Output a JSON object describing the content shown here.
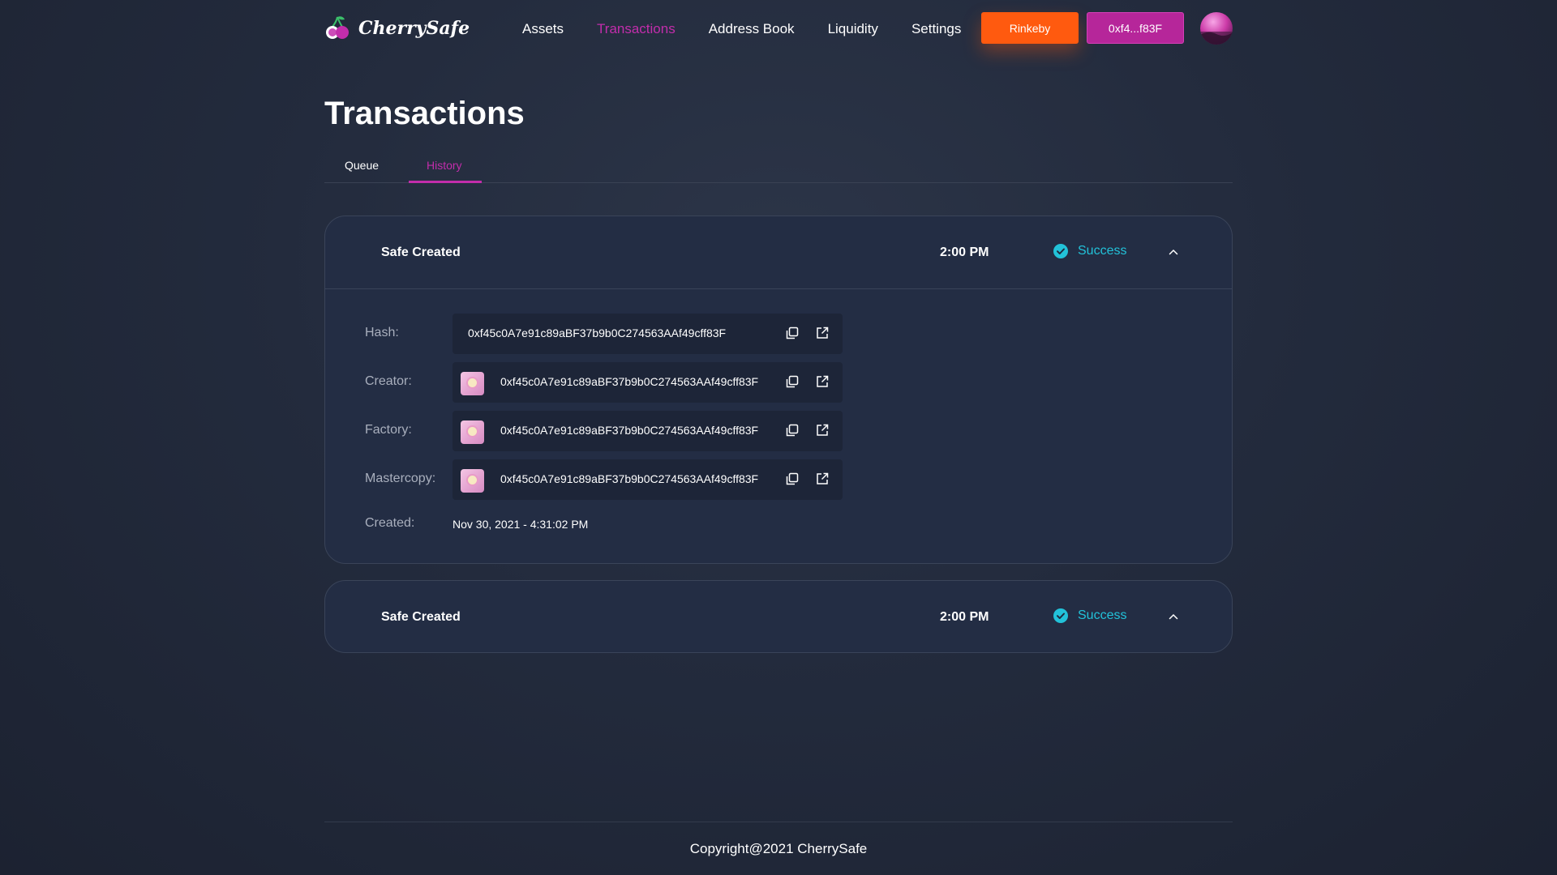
{
  "brand": {
    "name": "CherrySafe"
  },
  "nav": {
    "items": [
      {
        "label": "Assets",
        "active": false
      },
      {
        "label": "Transactions",
        "active": true
      },
      {
        "label": "Address Book",
        "active": false
      },
      {
        "label": "Liquidity",
        "active": false
      },
      {
        "label": "Settings",
        "active": false
      }
    ],
    "network_label": "Rinkeby",
    "wallet_label": "0xf4...f83F"
  },
  "page": {
    "title": "Transactions"
  },
  "tabs": [
    {
      "label": "Queue",
      "active": false
    },
    {
      "label": "History",
      "active": true
    }
  ],
  "transactions": [
    {
      "title": "Safe Created",
      "time": "2:00 PM",
      "status": "Success",
      "expanded": true,
      "details": {
        "hash_label": "Hash:",
        "hash": "0xf45c0A7e91c89aBF37b9b0C274563AAf49cff83F",
        "creator_label": "Creator:",
        "creator": "0xf45c0A7e91c89aBF37b9b0C274563AAf49cff83F",
        "factory_label": "Factory:",
        "factory": "0xf45c0A7e91c89aBF37b9b0C274563AAf49cff83F",
        "mastercopy_label": "Mastercopy:",
        "mastercopy": "0xf45c0A7e91c89aBF37b9b0C274563AAf49cff83F",
        "created_label": "Created:",
        "created": "Nov 30, 2021 - 4:31:02 PM"
      }
    },
    {
      "title": "Safe Created",
      "time": "2:00 PM",
      "status": "Success",
      "expanded": false
    }
  ],
  "footer": {
    "copyright": "Copyright@2021 CherrySafe"
  },
  "colors": {
    "accent": "#c22dab",
    "network_button": "#ff5a0f",
    "wallet_button": "#b6269a",
    "success": "#22c2d9",
    "card_bg": "#232d44"
  },
  "icons": [
    "cherry-logo-icon",
    "check-circle-icon",
    "chevron-up-icon",
    "copy-icon",
    "external-link-icon"
  ]
}
